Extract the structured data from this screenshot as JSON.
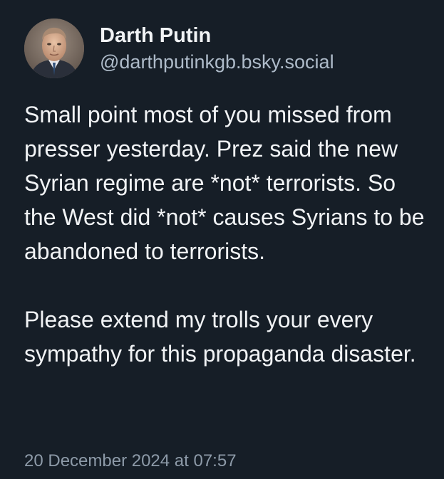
{
  "author": {
    "display_name": "Darth Putin",
    "handle": "@darthputinkgb.bsky.social",
    "avatar_icon": "profile-photo"
  },
  "post": {
    "paragraphs": [
      "Small point most of you missed from presser yesterday. Prez said the new Syrian regime are *not* terrorists. So the West did *not* causes Syrians to be abandoned to terrorists.",
      "Please extend my trolls your every sympathy for this propaganda disaster."
    ],
    "timestamp": "20 December 2024 at 07:57"
  },
  "colors": {
    "background": "#161e27",
    "text": "#f1f3f5",
    "handle": "#aebbc9",
    "timestamp": "#8d9aa8"
  }
}
